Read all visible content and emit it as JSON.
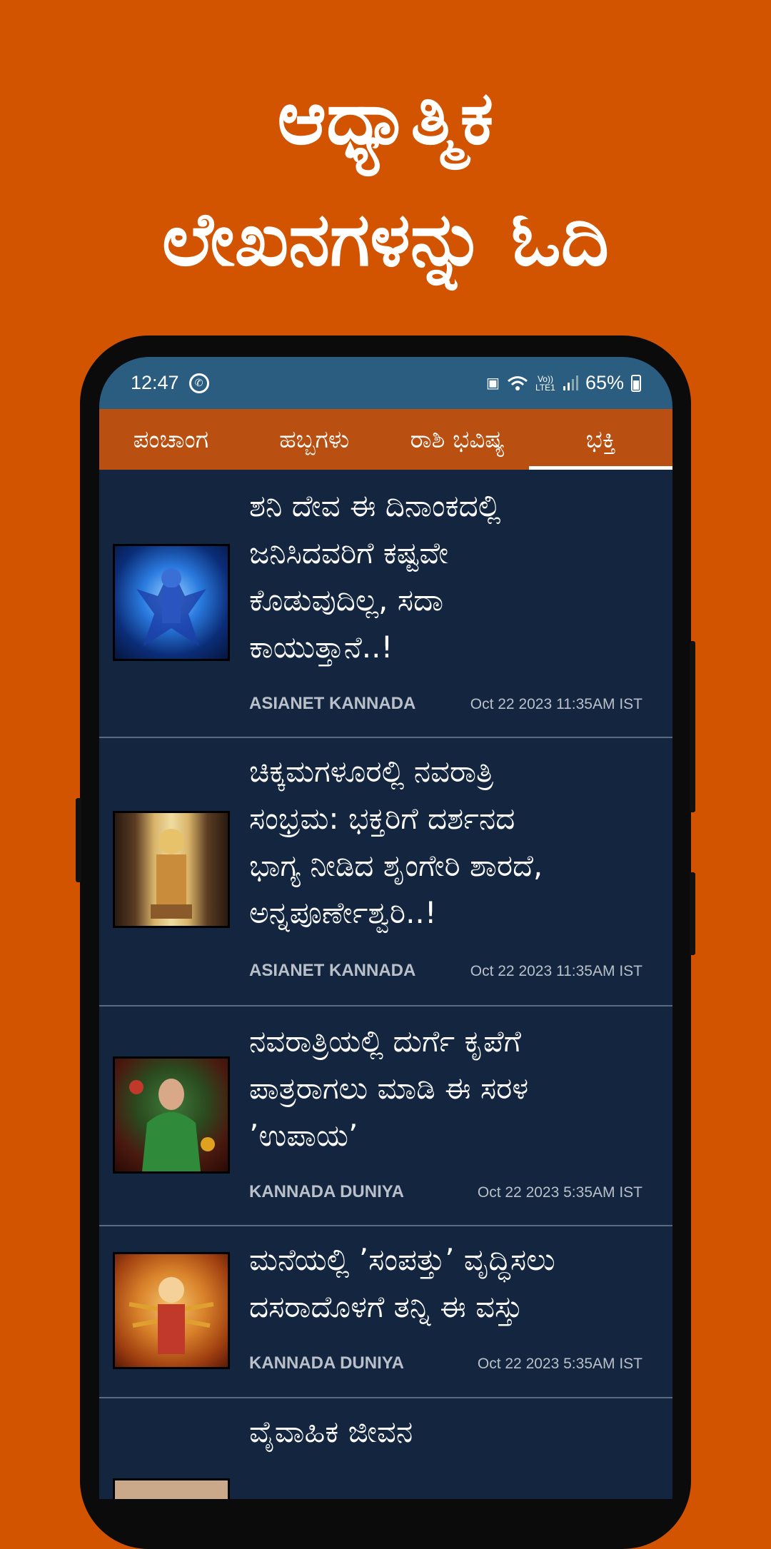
{
  "promo": {
    "line1": "ಆಧ್ಯಾತ್ಮಿಕ",
    "line2": "ಲೇಖನಗಳನ್ನು ಓದಿ"
  },
  "status_bar": {
    "time": "12:47",
    "battery": "65%",
    "network_label": "Vo)) LTE1"
  },
  "tabs": [
    {
      "label": "ಪಂಚಾಂಗ"
    },
    {
      "label": "ಹಬ್ಬಗಳು"
    },
    {
      "label": "ರಾಶಿ ಭವಿಷ್ಯ"
    },
    {
      "label": "ಭಕ್ತಿ"
    }
  ],
  "articles": [
    {
      "lines": [
        "ಶನಿ ದೇವ ಈ ದಿನಾಂಕದಲ್ಲಿ",
        "ಜನಿಸಿದವರಿಗೆ ಕಷ್ಟವೇ",
        "ಕೊಡುವುದಿಲ್ಲ, ಸದಾ",
        "ಕಾಯುತ್ತಾನೆ..!"
      ],
      "source": "ASIANET KANNADA",
      "date": "Oct 22 2023 11:35AM IST"
    },
    {
      "lines": [
        "ಚಿಕ್ಕಮಗಳೂರಲ್ಲಿ ನವರಾತ್ರಿ",
        "ಸಂಭ್ರಮ: ಭಕ್ತರಿಗೆ ದರ್ಶನದ",
        "ಭಾಗ್ಯ ನೀಡಿದ ಶೃಂಗೇರಿ ಶಾರದೆ,",
        "ಅನ್ನಪೂರ್ಣೇಶ್ವರಿ..!"
      ],
      "source": "ASIANET KANNADA",
      "date": "Oct 22 2023 11:35AM IST"
    },
    {
      "lines": [
        "ನವರಾತ್ರಿಯಲ್ಲಿ ದುರ್ಗೆ ಕೃಪೆಗೆ",
        "ಪಾತ್ರರಾಗಲು ಮಾಡಿ ಈ ಸರಳ",
        "’ಉಪಾಯ’"
      ],
      "source": "KANNADA DUNIYA",
      "date": "Oct 22 2023  5:35AM IST"
    },
    {
      "lines": [
        "ಮನೆಯಲ್ಲಿ ’ಸಂಪತ್ತು’ ವೃದ್ಧಿಸಲು",
        "ದಸರಾದೊಳಗೆ ತನ್ನಿ ಈ ವಸ್ತು"
      ],
      "source": "KANNADA DUNIYA",
      "date": "Oct 22 2023  5:35AM IST"
    },
    {
      "lines": [
        "ವೈವಾಹಿಕ ಜೀವನ"
      ],
      "source": "",
      "date": ""
    }
  ],
  "icons": {
    "whatsapp": "whatsapp-icon",
    "wifi": "wifi-icon",
    "signal": "signal-icon",
    "battery": "battery-icon"
  }
}
